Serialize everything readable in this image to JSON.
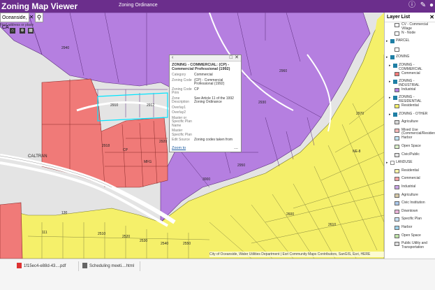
{
  "header": {
    "title": "Zoning Map Viewer",
    "subtitle": "Zoning Ordinance"
  },
  "search": {
    "value": "Oceanside, CA",
    "hint": "Find address or place"
  },
  "popup": {
    "title": "ZONING - COMMERCIAL: (CP) - Commercial Professional (1992)",
    "fields": [
      {
        "label": "Category",
        "value": "Commercial"
      },
      {
        "label": "Zoning Code",
        "value": "(CP) - Commercial Professional (1992)"
      },
      {
        "label": "Zoning Code Prim",
        "value": "CP"
      },
      {
        "label": "Zone Description",
        "value": "See Article 11 of the 1992 Zoning Ordinance"
      },
      {
        "label": "Overlay1",
        "value": ""
      },
      {
        "label": "Overlay2",
        "value": ""
      },
      {
        "label": "Master or Specific Plan Name",
        "value": ""
      },
      {
        "label": "Master Specific Plan",
        "value": ""
      },
      {
        "label": "Edit Source",
        "value": "Zoning codes taken from"
      }
    ],
    "zoom_label": "Zoom to",
    "more_label": "..."
  },
  "layer_list": {
    "title": "Layer List",
    "items": [
      {
        "label": "CV - Commercial Village",
        "color": "#ffffff",
        "indent": 2,
        "kind": "swatch"
      },
      {
        "label": "N - Node",
        "color": "#ffffff",
        "indent": 2,
        "kind": "swatch"
      },
      {
        "label": "PARCEL",
        "indent": 0,
        "kind": "check",
        "checked": true
      },
      {
        "label": "",
        "color": "#ffffff",
        "indent": 2,
        "kind": "swatch"
      },
      {
        "label": "ZONING",
        "indent": 0,
        "kind": "check",
        "checked": true
      },
      {
        "label": "ZONING - COMMERCIAL",
        "indent": 1,
        "kind": "check",
        "checked": true
      },
      {
        "label": "Commercial",
        "color": "#f07a78",
        "indent": 2,
        "kind": "swatch"
      },
      {
        "label": "ZONING - INDUSTRIAL",
        "indent": 1,
        "kind": "check",
        "checked": true
      },
      {
        "label": "Industrial",
        "color": "#b57fe0",
        "indent": 2,
        "kind": "swatch"
      },
      {
        "label": "ZONING - RESIDENTIAL",
        "indent": 1,
        "kind": "check",
        "checked": true
      },
      {
        "label": "Residential",
        "color": "#f5f06a",
        "indent": 2,
        "kind": "swatch"
      },
      {
        "label": "ZONING - OTHER",
        "indent": 1,
        "kind": "check",
        "checked": true
      },
      {
        "label": "Agriculture",
        "color": "#d8d8d8",
        "indent": 2,
        "kind": "swatch"
      },
      {
        "label": "Mixed Use (Commercial/Residential)",
        "color": "#f3b7b7",
        "indent": 2,
        "kind": "swatch"
      },
      {
        "label": "Harbor",
        "color": "#bfe3f5",
        "indent": 2,
        "kind": "swatch"
      },
      {
        "label": "Open Space",
        "color": "#d9efc7",
        "indent": 2,
        "kind": "swatch"
      },
      {
        "label": "Civic/Public",
        "color": "#e3e3e3",
        "indent": 2,
        "kind": "swatch"
      },
      {
        "label": "LANDUSE",
        "indent": 0,
        "kind": "check",
        "checked": false
      },
      {
        "label": "Residential",
        "color": "#faf2a8",
        "indent": 2,
        "kind": "swatch"
      },
      {
        "label": "Commercial",
        "color": "#f4a3a3",
        "indent": 2,
        "kind": "swatch"
      },
      {
        "label": "Industrial",
        "color": "#c9a3e6",
        "indent": 2,
        "kind": "swatch"
      },
      {
        "label": "Agriculture",
        "color": "#d7c9a8",
        "indent": 2,
        "kind": "swatch"
      },
      {
        "label": "Civic Institution",
        "color": "#a9c7ea",
        "indent": 2,
        "kind": "swatch"
      },
      {
        "label": "Downtown",
        "color": "#e8b3d8",
        "indent": 2,
        "kind": "swatch"
      },
      {
        "label": "Specific Plan",
        "color": "#c6dff5",
        "indent": 2,
        "kind": "swatch"
      },
      {
        "label": "Harbor",
        "color": "#9bd0ea",
        "indent": 2,
        "kind": "swatch"
      },
      {
        "label": "Open Space",
        "color": "#bfe3a8",
        "indent": 2,
        "kind": "swatch"
      },
      {
        "label": "Public Utility and Transportation",
        "color": "#dcdcdc",
        "indent": 2,
        "kind": "swatch"
      }
    ]
  },
  "map": {
    "labels": {
      "lbl_2940": "2940",
      "lbl_2910": "2910",
      "lbl_2912": "2912",
      "lbl_2918": "2918",
      "lbl_2920": "2920",
      "lbl_2930": "2930",
      "lbl_2950": "2950",
      "lbl_2960": "2960",
      "lbl_2970": "2970",
      "lbl_3000": "3000",
      "lbl_130": "130",
      "lbl_111": "111",
      "lbl_2510": "2510",
      "lbl_2520": "2520",
      "lbl_2530": "2530",
      "lbl_2540": "2540",
      "lbl_2550": "2550",
      "lbl_2600": "2600",
      "lbl_2610": "2610",
      "lbl_ne": "NE-8",
      "lbl_caltran": "CALTRAN",
      "lbl_cp": "CP",
      "lbl_mfg": "MFG"
    }
  },
  "attribution": "City of Oceanside, Water Utilities Department | Esri Community Maps Contributors, SanGIS, Esri, HERE",
  "downloads": [
    {
      "label": "1f15ec4-e88d-43....pdf",
      "icon": "pdf-file-icon"
    },
    {
      "label": "Scheduling meeti....html",
      "icon": "html-file-icon"
    }
  ],
  "colors": {
    "header": "#6b2e8c",
    "industrial": "#b57fe0",
    "commercial": "#f07a78",
    "residential": "#f5f06a",
    "accent": "#1f7fa5"
  }
}
